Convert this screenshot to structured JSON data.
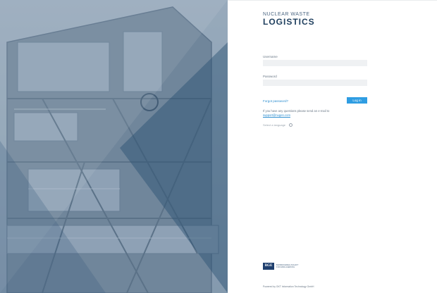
{
  "brand": {
    "top_line": "NUCLEAR WASTE",
    "main_line": "LOGISTICS"
  },
  "login": {
    "username_label": "Username",
    "username_value": "",
    "password_label": "Password",
    "password_value": "",
    "forgot_label": "Forgot password?",
    "login_label": "Log in"
  },
  "help": {
    "text": "If you have any questions please send an e-mail to",
    "email": "support@nugen.com"
  },
  "language": {
    "label": "Select a language"
  },
  "footer": {
    "logo_text": "BGE",
    "logo_subtitle": "BUNDESGESELLSCHAFT FÜR ENDLAGERUNG",
    "powered_by": "Powered by GKT Information Technology GmbH"
  },
  "colors": {
    "brand": "#20405f",
    "accent": "#2f9de2",
    "hero_overlay": "#4a6a88"
  },
  "icons": {
    "language": "globe-icon"
  }
}
